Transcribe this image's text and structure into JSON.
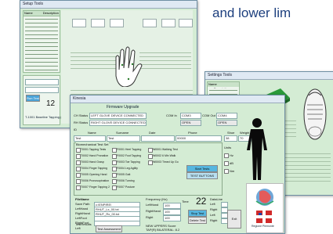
{
  "caption": "and lower lim",
  "win1": {
    "menu": "Setup  Tools",
    "col1": "Name",
    "col2": "Description",
    "count": "12",
    "small_btn": "Run Test",
    "info_line": "T-1001 Baseline Tapping (1 of 3)"
  },
  "win2": {
    "menu": "Settings  Tools",
    "col1": "Name",
    "col2": "Description"
  },
  "win3": {
    "title": "Kinesia",
    "header": "Firmware Upgrade",
    "ch_status_label": "CH Status",
    "ch_status_value": "LEFT GLOVE DEVICE CONNECTED",
    "rh_status_label": "RH Status",
    "rh_status_value": "RIGHT GLOVE DEVICE CONNECTED",
    "com_label_left": "COM In",
    "com_value_left": "COM3",
    "com_label_right": "COM Out",
    "com_value_right": "COM4",
    "open1": "OPEN",
    "open2": "OPEN",
    "id_label": "ID",
    "name_col": "Name",
    "surname_col": "Surname",
    "date_col": "Date",
    "phone_col": "Phone",
    "shoe_col": "Shoe",
    "weight_col": "Weight",
    "name_value": "Test",
    "surname_value": "Test",
    "phone_value": "00000",
    "shoe_value": "38",
    "weight_value": "70",
    "tests_label": "Biomechanical Test Set",
    "tests": [
      "T0001 Tapping Tests",
      "T0002 Hand Pronation",
      "T0003 Hand Grasp",
      "T0004 Finger Tapping",
      "T0005 Opening Hand",
      "T0006 Pronosupination",
      "T0007 Finger Tapping 2",
      "F0001 Heel Tapping",
      "F0002 Foot Tapping",
      "F0003 Toe Tapping",
      "F0004 Leg Agility",
      "F0005 Gait",
      "F0006 Turning",
      "F0007 Posture",
      "W0001 Walking Test",
      "W0002 6 Min Walk",
      "W0003 Timed Up Go"
    ],
    "start_test": "Start Tests",
    "test_buttons": "TEST BUTTONS",
    "units_label": "Units",
    "units": [
      "Hz",
      "dB",
      "Nm"
    ],
    "files_label": "FileName",
    "files": [
      {
        "k": "Save Path",
        "v": "c:\\ENPIRE\\"
      },
      {
        "k": "LeftHand",
        "v": "RHUT_Lx_00.txt"
      },
      {
        "k": "RightHand",
        "v": "RHUT_Rx_00.txt"
      },
      {
        "k": "LeftFoot",
        "v": ""
      },
      {
        "k": "RightFoot",
        "v": ""
      }
    ],
    "tests_results_label": "TestResults",
    "results": [
      "Left",
      "Right",
      "Left",
      "Right"
    ],
    "freq_label": "Frequency (Hz)",
    "freq_rows": [
      {
        "k": "LeftHand",
        "v": "100"
      },
      {
        "k": "RightHand",
        "v": "100"
      },
      {
        "k": "Right",
        "v": "100"
      }
    ],
    "time_label": "Time",
    "time_value": "22",
    "stop_test": "Stop Test",
    "delete_test": "Delete Test",
    "data_label": "DataLine",
    "data_rows": [
      "Left",
      "Right",
      "Left",
      "Right"
    ],
    "spo_label": "NEW UPPERS Score",
    "spo_value": "TAP(R) BILATERAL: 8.2",
    "test_assessment": "Test Assessment",
    "exit_btn": "Exit",
    "flag_caption": "Regione Piemonte"
  }
}
